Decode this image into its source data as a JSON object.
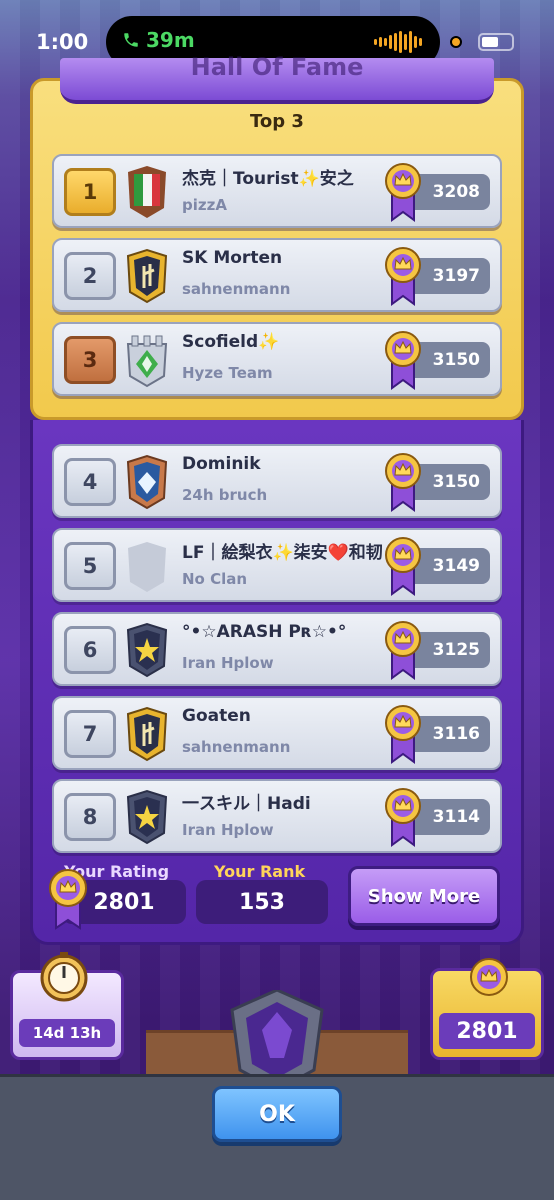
{
  "status_bar": {
    "time": "1:00",
    "call_duration": "39m"
  },
  "title_banner": "Hall Of Fame",
  "top3_label": "Top 3",
  "leaderboard": [
    {
      "rank": "1",
      "name": "杰克｜Tourist✨安之",
      "clan": "pizzA",
      "score": "3208",
      "rank_style": "gold",
      "badge": "italy-flag-badge"
    },
    {
      "rank": "2",
      "name": "SK Morten",
      "clan": "sahnenmann",
      "score": "3197",
      "rank_style": "silver",
      "badge": "gold-shield-badge"
    },
    {
      "rank": "3",
      "name": "Scofield✨",
      "clan": "Hyze Team",
      "score": "3150",
      "rank_style": "bronze",
      "badge": "green-tower-badge"
    },
    {
      "rank": "4",
      "name": "Dominik",
      "clan": "24h bruch",
      "score": "3150",
      "rank_style": "silver",
      "badge": "blue-diamond-badge"
    },
    {
      "rank": "5",
      "name": "LF｜絵梨衣✨柒安❤️和韧",
      "clan": "No Clan",
      "score": "3149",
      "rank_style": "silver",
      "badge": "empty-shield-badge"
    },
    {
      "rank": "6",
      "name": "°•☆ARASH Pʀ☆•°",
      "clan": "Iran Hplow",
      "score": "3125",
      "rank_style": "silver",
      "badge": "star-shield-badge"
    },
    {
      "rank": "7",
      "name": "Goaten",
      "clan": "sahnenmann",
      "score": "3116",
      "rank_style": "silver",
      "badge": "gold-shield-badge"
    },
    {
      "rank": "8",
      "name": "一スキル｜Hadi",
      "clan": "Iran Hplow",
      "score": "3114",
      "rank_style": "silver",
      "badge": "star-shield-badge"
    }
  ],
  "your_rating": {
    "label": "Your Rating",
    "value": "2801"
  },
  "your_rank": {
    "label": "Your Rank",
    "value": "153"
  },
  "show_more_label": "Show More",
  "season_timer": "14d 13h",
  "trophy_count": "2801",
  "ok_label": "OK",
  "colors": {
    "gold": "#f2c94c",
    "purple": "#5426a8",
    "ok_blue": "#3f93ee"
  }
}
